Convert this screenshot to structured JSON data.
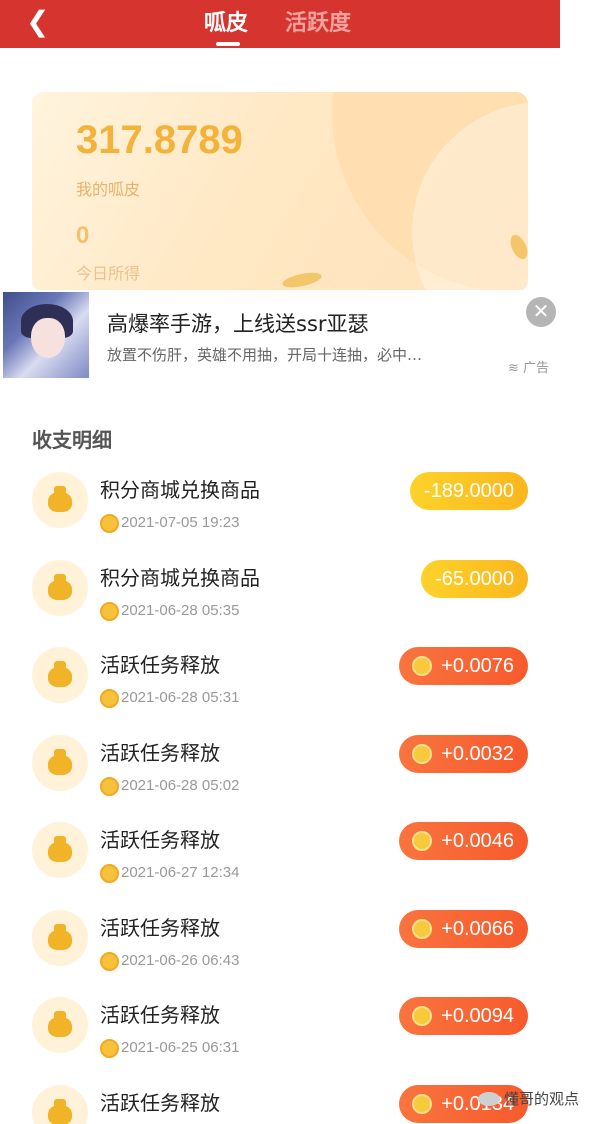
{
  "header": {
    "back_icon": "chevron-left-icon",
    "tabs": [
      {
        "label": "呱皮",
        "active": true
      },
      {
        "label": "活跃度",
        "active": false
      }
    ],
    "background_color": "#d5342f"
  },
  "wallet": {
    "balance": "317.8789",
    "balance_label": "我的呱皮",
    "today": "0",
    "today_label": "今日所得"
  },
  "ad": {
    "title": "高爆率手游，上线送ssr亚瑟",
    "description": "放置不伤肝，英雄不用抽，开局十连抽，必中…",
    "tag": "广告",
    "close_icon": "close-icon"
  },
  "section": {
    "title": "收支明细"
  },
  "records": [
    {
      "title": "积分商城兑换商品",
      "date": "2021-07-05 19:23",
      "amount": "-189.0000",
      "type": "neg"
    },
    {
      "title": "积分商城兑换商品",
      "date": "2021-06-28 05:35",
      "amount": "-65.0000",
      "type": "neg"
    },
    {
      "title": "活跃任务释放",
      "date": "2021-06-28 05:31",
      "amount": "+0.0076",
      "type": "pos"
    },
    {
      "title": "活跃任务释放",
      "date": "2021-06-28 05:02",
      "amount": "+0.0032",
      "type": "pos"
    },
    {
      "title": "活跃任务释放",
      "date": "2021-06-27 12:34",
      "amount": "+0.0046",
      "type": "pos"
    },
    {
      "title": "活跃任务释放",
      "date": "2021-06-26 06:43",
      "amount": "+0.0066",
      "type": "pos"
    },
    {
      "title": "活跃任务释放",
      "date": "2021-06-25 06:31",
      "amount": "+0.0094",
      "type": "pos"
    },
    {
      "title": "活跃任务释放",
      "date": "",
      "amount": "+0.0134",
      "type": "pos"
    }
  ],
  "watermark": "懂哥的观点"
}
